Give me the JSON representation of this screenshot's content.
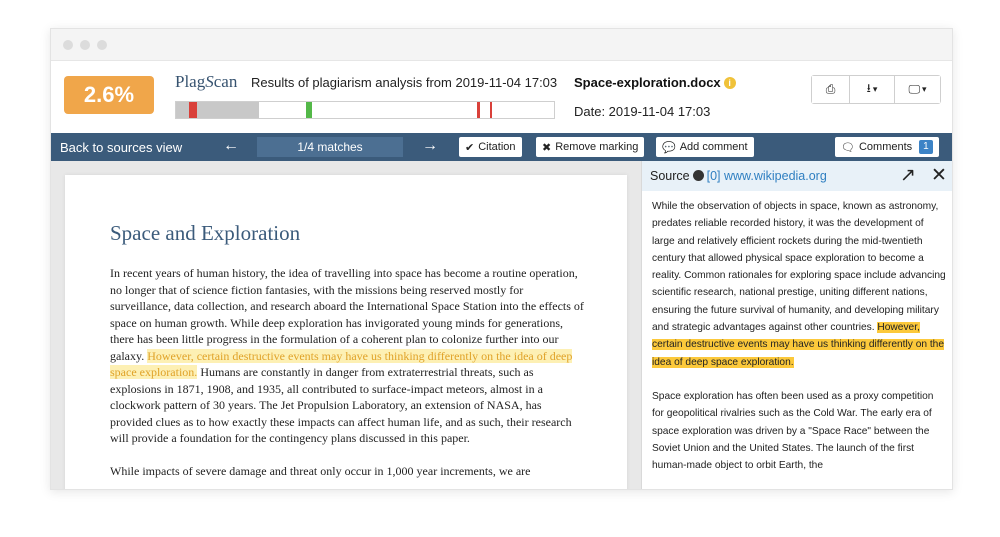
{
  "score": "2.6%",
  "logo": {
    "part1": "Plag",
    "part2": "S",
    "part3": "can"
  },
  "result_title": "Results of plagiarism analysis from 2019-11-04 17:03",
  "file": {
    "name": "Space-exploration.docx",
    "date": "Date: 2019-11-04 17:03",
    "info_glyph": "i"
  },
  "matchbar": [
    {
      "start": 0.0,
      "width": 0.22,
      "color": "#c8c8c8"
    },
    {
      "start": 0.035,
      "width": 0.02,
      "color": "#d9403a"
    },
    {
      "start": 0.345,
      "width": 0.015,
      "color": "#53b848"
    },
    {
      "start": 0.795,
      "width": 0.008,
      "color": "#d9403a"
    },
    {
      "start": 0.832,
      "width": 0.005,
      "color": "#d9403a"
    }
  ],
  "header_buttons": {
    "print_icon": "⎙",
    "download_icon": "⭳",
    "display_icon": "🖵",
    "caret": "▾"
  },
  "toolbar": {
    "back": "Back to sources view",
    "prev_arrow": "←",
    "next_arrow": "→",
    "counter": "1/4 matches",
    "citation": "Citation",
    "citation_icon": "✔",
    "remove": "Remove marking",
    "remove_icon": "✖",
    "add_comment": "Add comment",
    "add_comment_icon": "💬",
    "comments": "Comments",
    "comments_icon": "🗨",
    "comments_count": "1"
  },
  "document": {
    "title": "Space and Exploration",
    "p1_before": "In recent years of human history, the idea of travelling into space has become a routine operation, no longer that of science fiction fantasies, with the missions being reserved mostly for surveillance, data collection, and research aboard the International Space Station into the effects of space on human growth. While deep exploration has invigorated young minds for generations, there has been little progress in the formulation of a coherent plan to colonize further into our galaxy. ",
    "p1_highlight": "However, certain destructive events may have us thinking differently on the idea of deep space exploration.",
    "p1_after": " Humans are constantly in danger from extraterrestrial threats, such as explosions in 1871, 1908, and 1935, all contributed to surface-impact meteors, almost in a clockwork pattern of 30 years. The Jet Propulsion Laboratory, an extension of NASA, has provided clues as to how exactly these impacts can affect human life, and as such, their research will provide a foundation for the contingency plans discussed in this paper.",
    "p2": "While impacts of severe damage and threat only occur in 1,000 year increments, we are"
  },
  "source": {
    "label": "Source",
    "link": "[0] www.wikipedia.org",
    "open_icon": "↗",
    "close_icon": "✕",
    "p1_before": "While the observation of objects in space, known as astronomy, predates reliable recorded history, it was the development of large and relatively efficient rockets during the mid-twentieth century that allowed physical space exploration to become a reality. Common rationales for exploring space include advancing scientific research, national prestige, uniting different nations, ensuring the future survival of humanity, and developing military and strategic advantages against other countries. ",
    "p1_highlight": "However, certain destructive events may have us thinking differently on the idea of deep space exploration.",
    "p2": "Space exploration has often been used as a proxy competition for geopolitical rivalries such as the Cold War. The early era of space exploration was driven by a \"Space Race\" between the Soviet Union and the United States. The launch of the first human-made object to orbit Earth, the"
  }
}
